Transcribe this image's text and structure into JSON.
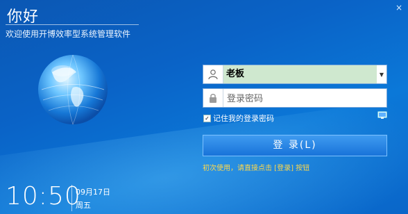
{
  "window": {
    "close_glyph": "×"
  },
  "header": {
    "greeting": "你好",
    "subtitle": "欢迎使用开博效率型系统管理软件"
  },
  "login": {
    "username_value": "老板",
    "password_placeholder": "登录密码",
    "remember_label": "记住我的登录密码",
    "remember_checked": true,
    "login_button_label": "登 录(L)",
    "hint": "初次使用，请直接点击 [登录] 按钮"
  },
  "clock": {
    "time": "10:50",
    "date": "09月17日",
    "weekday": "周五"
  },
  "icons": [
    "user-icon",
    "lock-icon",
    "dropdown-arrow-icon",
    "monitor-icon",
    "globe-icon",
    "close-icon"
  ],
  "colors": {
    "background": "#0a63c7",
    "username_highlight": "#cfe8cf",
    "hint_text": "#ffd84a",
    "login_button": "#1873d9"
  }
}
